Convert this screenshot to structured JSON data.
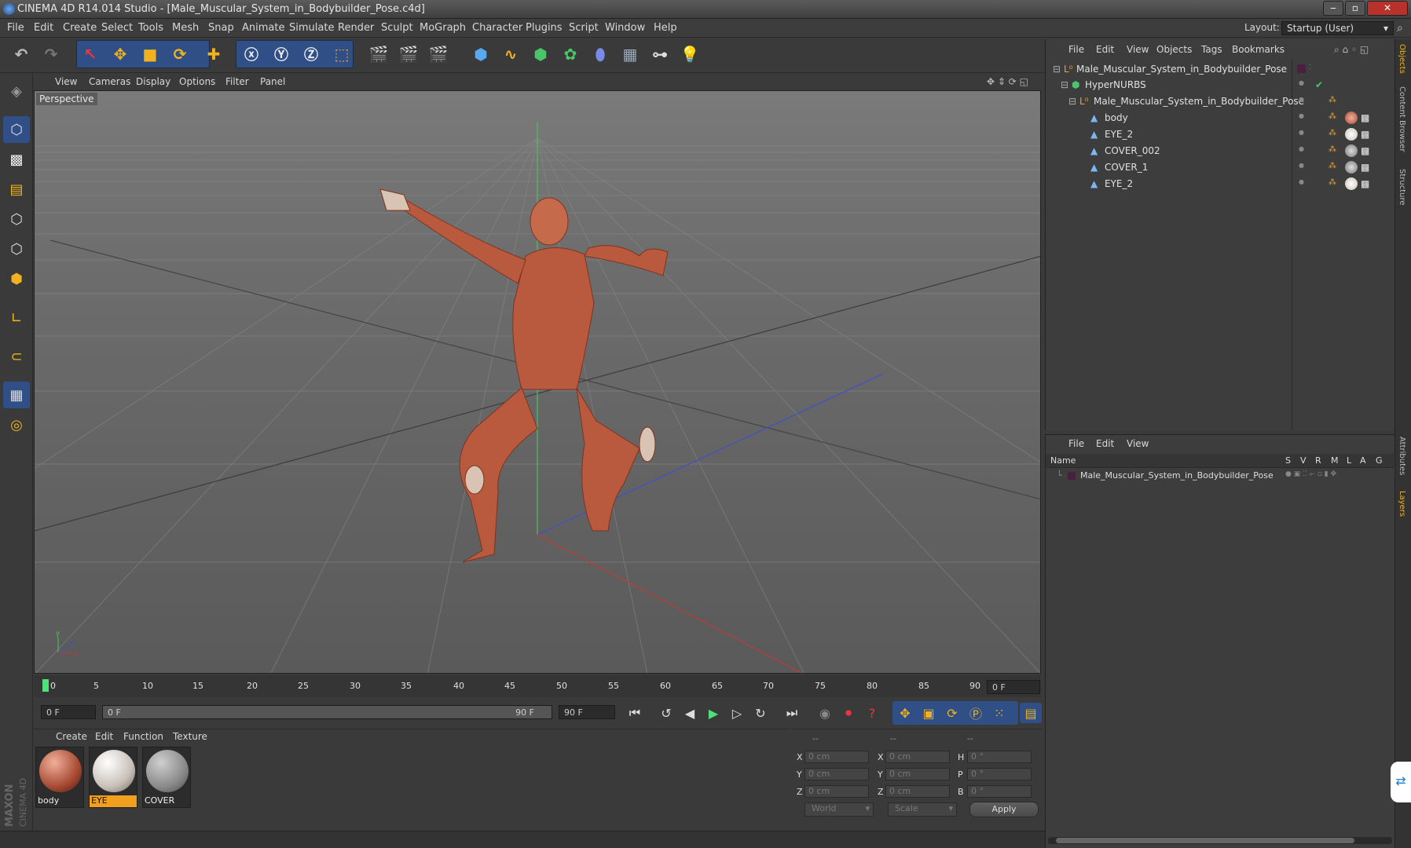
{
  "window": {
    "title": "CINEMA 4D R14.014 Studio - [Male_Muscular_System_in_Bodybuilder_Pose.c4d]"
  },
  "menu": [
    "File",
    "Edit",
    "Create",
    "Select",
    "Tools",
    "Mesh",
    "Snap",
    "Animate",
    "Simulate",
    "Render",
    "Sculpt",
    "MoGraph",
    "Character",
    "Plugins",
    "Script",
    "Window",
    "Help"
  ],
  "layout": {
    "label": "Layout:",
    "value": "Startup (User)"
  },
  "viewport": {
    "menu": [
      "View",
      "Cameras",
      "Display",
      "Options",
      "Filter",
      "Panel"
    ],
    "label": "Perspective"
  },
  "timeline": {
    "ticks": [
      "0",
      "5",
      "10",
      "15",
      "20",
      "25",
      "30",
      "35",
      "40",
      "45",
      "50",
      "55",
      "60",
      "65",
      "70",
      "75",
      "80",
      "85",
      "90"
    ],
    "current_frame": "0 F",
    "start": "0 F",
    "range_start": "0 F",
    "range_end": "90 F",
    "end": "90 F"
  },
  "material_manager": {
    "menu": [
      "Create",
      "Edit",
      "Function",
      "Texture"
    ],
    "materials": [
      {
        "name": "body"
      },
      {
        "name": "EYE"
      },
      {
        "name": "COVER"
      }
    ]
  },
  "coordinates": {
    "headers": [
      "--",
      "--",
      "--"
    ],
    "rows": [
      {
        "a": "X",
        "av": "0 cm",
        "b": "X",
        "bv": "0 cm",
        "c": "H",
        "cv": "0 °"
      },
      {
        "a": "Y",
        "av": "0 cm",
        "b": "Y",
        "bv": "0 cm",
        "c": "P",
        "cv": "0 °"
      },
      {
        "a": "Z",
        "av": "0 cm",
        "b": "Z",
        "bv": "0 cm",
        "c": "B",
        "cv": "0 °"
      }
    ],
    "world": "World",
    "scale": "Scale",
    "apply": "Apply"
  },
  "object_manager": {
    "menu": [
      "File",
      "Edit",
      "View",
      "Objects",
      "Tags",
      "Bookmarks"
    ],
    "objects": [
      {
        "name": "Male_Muscular_System_in_Bodybuilder_Pose"
      },
      {
        "name": "HyperNURBS"
      },
      {
        "name": "Male_Muscular_System_in_Bodybuilder_Pose"
      },
      {
        "name": "body"
      },
      {
        "name": "EYE_2"
      },
      {
        "name": "COVER_002"
      },
      {
        "name": "COVER_1"
      },
      {
        "name": "EYE_2"
      }
    ]
  },
  "layer_manager": {
    "menu": [
      "File",
      "Edit",
      "View"
    ],
    "columns": [
      "Name",
      "S",
      "V",
      "R",
      "M",
      "L",
      "A",
      "G"
    ],
    "row": "Male_Muscular_System_in_Bodybuilder_Pose"
  },
  "side_tabs": [
    "Objects",
    "Content Browser",
    "Structure",
    "Attributes",
    "Layers"
  ],
  "brand": {
    "line1": "MAXON",
    "line2": "CINEMA 4D"
  }
}
